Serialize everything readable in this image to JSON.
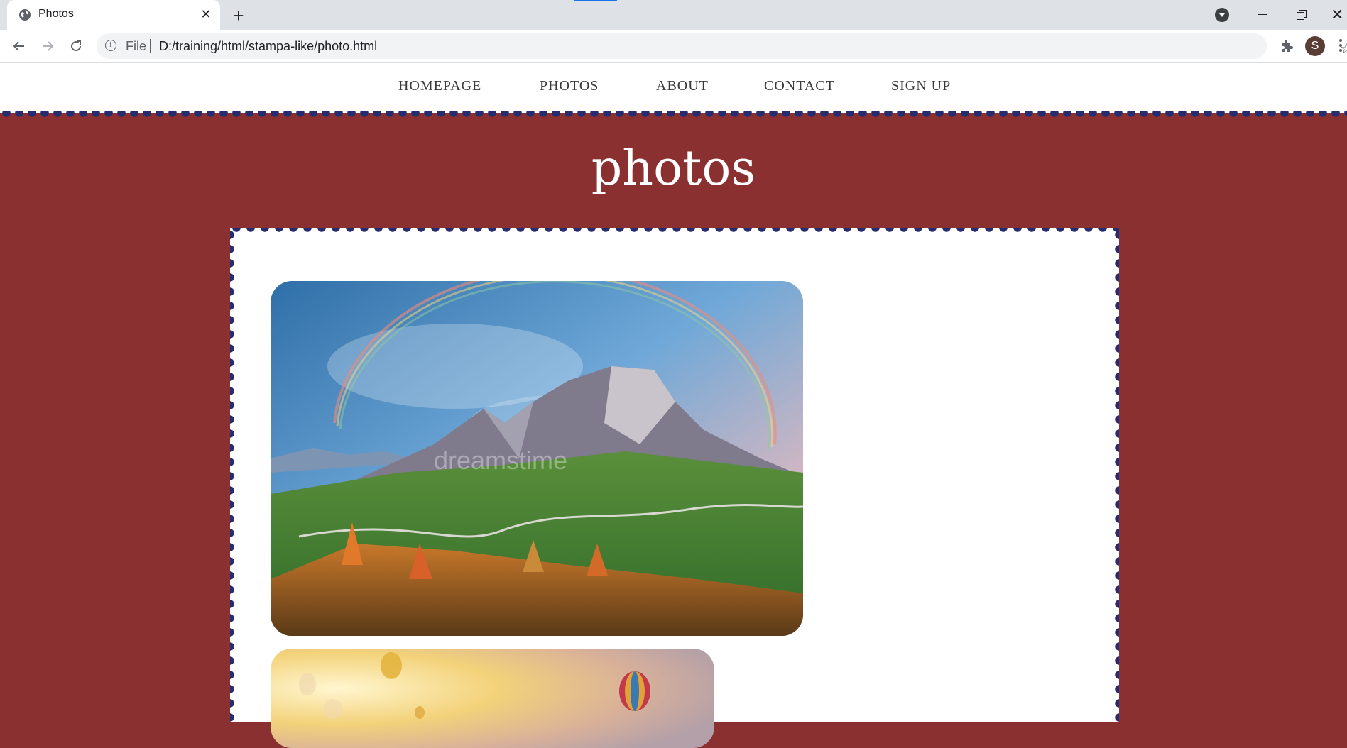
{
  "browser": {
    "tab_title": "Photos",
    "close_glyph": "✕",
    "new_tab_glyph": "+",
    "url_scheme": "File",
    "url": "D:/training/html/stampa-like/photo.html",
    "avatar_initial": "S",
    "icons": [
      "globe-icon",
      "back-icon",
      "forward-icon",
      "reload-icon",
      "info-icon",
      "star-icon",
      "extensions-icon",
      "menu-icon"
    ]
  },
  "nav": {
    "items": [
      "HOMEPAGE",
      "PHOTOS",
      "ABOUT",
      "CONTACT",
      "SIGN UP"
    ]
  },
  "page": {
    "title": "photos"
  },
  "colors": {
    "page_background": "#8b3030",
    "scallop": "#252c70",
    "card": "#ffffff"
  },
  "photos": [
    {
      "subject": "mountain landscape with rainbow and winding road",
      "watermark": "dreamstime"
    },
    {
      "subject": "hot air balloons in golden sky"
    }
  ]
}
